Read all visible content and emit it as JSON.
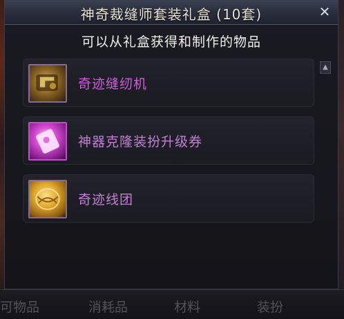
{
  "window": {
    "title": "神奇裁缝师套装礼盒 (10套)",
    "close_glyph": "✕"
  },
  "subtitle": "可以从礼盒获得和制作的物品",
  "items": [
    {
      "label": "奇迹缝纫机",
      "icon": "sewing-machine-icon"
    },
    {
      "label": "神器克隆装扮升级券",
      "icon": "upgrade-ticket-icon"
    },
    {
      "label": "奇迹线团",
      "icon": "yarn-ball-icon"
    }
  ],
  "scroll_up_glyph": "▲",
  "bottom_tabs": [
    "可物品",
    "消耗品",
    "材料",
    "装扮"
  ],
  "colors": {
    "item_rare": "#d15ae0",
    "item_epic": "#c57fd6"
  }
}
